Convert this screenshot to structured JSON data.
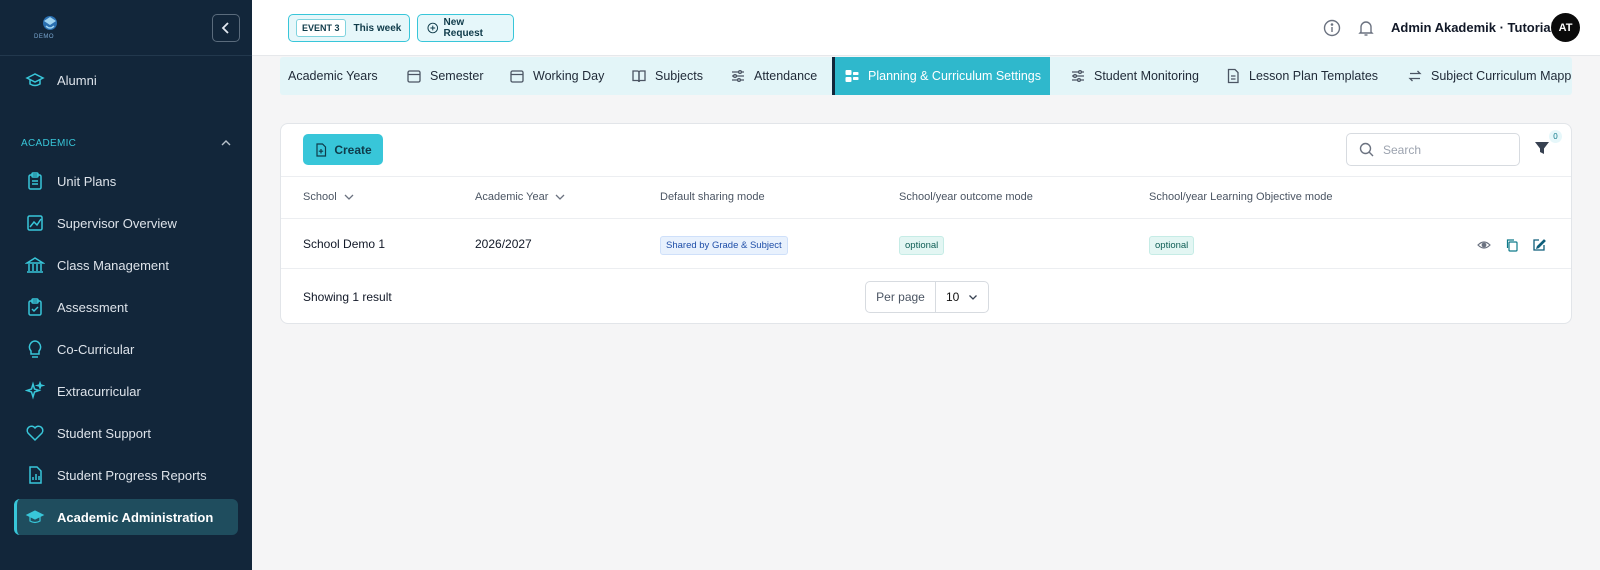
{
  "sidebar": {
    "logo_text": "DEMO",
    "items_top": [
      {
        "label": "Alumni",
        "icon": "graduation-cap-icon"
      }
    ],
    "section": {
      "label": "ACADEMIC"
    },
    "items": [
      {
        "label": "Unit Plans",
        "icon": "clipboard-icon"
      },
      {
        "label": "Supervisor Overview",
        "icon": "chart-icon"
      },
      {
        "label": "Class Management",
        "icon": "building-icon"
      },
      {
        "label": "Assessment",
        "icon": "clipboard-check-icon"
      },
      {
        "label": "Co-Curricular",
        "icon": "lightbulb-icon"
      },
      {
        "label": "Extracurricular",
        "icon": "sparkles-icon"
      },
      {
        "label": "Student Support",
        "icon": "heart-icon"
      },
      {
        "label": "Student Progress Reports",
        "icon": "report-icon"
      },
      {
        "label": "Academic Administration",
        "icon": "graduation-cap-icon",
        "active": true
      }
    ]
  },
  "topbar": {
    "event_badge": "EVENT 3",
    "event_label": "This week",
    "new_request_label": "New Request",
    "user_name": "Admin Akademik · Tutorial",
    "avatar_initials": "AT"
  },
  "tabs": [
    {
      "label": "Academic Years",
      "icon": ""
    },
    {
      "label": "Semester",
      "icon": "calendar-icon"
    },
    {
      "label": "Working Day",
      "icon": "calendar-icon"
    },
    {
      "label": "Subjects",
      "icon": "book-icon"
    },
    {
      "label": "Attendance",
      "icon": "sliders-icon"
    },
    {
      "label": "Planning & Curriculum Settings",
      "icon": "settings-grid-icon",
      "active": true
    },
    {
      "label": "Student Monitoring",
      "icon": "sliders-icon"
    },
    {
      "label": "Lesson Plan Templates",
      "icon": "file-icon"
    },
    {
      "label": "Subject Curriculum Mappi",
      "icon": "swap-icon"
    }
  ],
  "toolbar": {
    "create_label": "Create",
    "search_placeholder": "Search",
    "filter_count": "0"
  },
  "table": {
    "columns": [
      "School",
      "Academic Year",
      "Default sharing mode",
      "School/year outcome mode",
      "School/year Learning Objective mode"
    ],
    "rows": [
      {
        "school": "School Demo 1",
        "academic_year": "2026/2027",
        "sharing_mode": "Shared by Grade & Subject",
        "outcome_mode": "optional",
        "objective_mode": "optional"
      }
    ]
  },
  "footer": {
    "result_text": "Showing 1 result",
    "per_page_label": "Per page",
    "per_page_value": "10"
  },
  "colors": {
    "sidebar_bg": "#12263a",
    "accent": "#38c6d9",
    "active_tab": "#2fb8cc"
  }
}
